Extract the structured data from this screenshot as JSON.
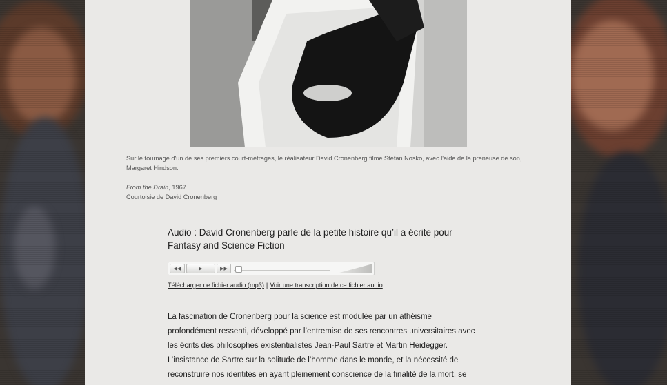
{
  "photo": {
    "icon": "photograph"
  },
  "caption": {
    "line1": "Sur le tournage d'un de ses premiers court-métrages, le réalisateur David Cronenberg filme Stefan Nosko, avec l'aide de la preneuse de son,",
    "line2": "Margaret Hindson.",
    "work_title": "From the Drain",
    "work_year": ", 1967",
    "credit": "Courtoisie de David Cronenberg"
  },
  "audio": {
    "title": "Audio : David Cronenberg parle de la petite histoire qu’il a écrite pour Fantasy and Science Fiction",
    "player": {
      "rewind_icon": "rewind-icon",
      "play_icon": "play-icon",
      "forward_icon": "fast-forward-icon",
      "progress": 0
    },
    "download_link": "Télécharger ce fichier audio (mp3)",
    "separator": "|",
    "transcript_link": "Voir une transcription de ce fichier audio"
  },
  "body": {
    "lines": [
      "La fascination de Cronenberg pour la science est modulée par un athéisme",
      "profondément ressenti, développé par l’entremise de ses rencontres universitaires avec",
      "les écrits des philosophes existentialistes Jean-Paul Sartre et Martin Heidegger.",
      "L’insistance de Sartre sur la solitude de l’homme dans le monde, et la nécessité de",
      "reconstruire nos identités en ayant pleinement conscience de la finalité de la mort, se"
    ]
  }
}
